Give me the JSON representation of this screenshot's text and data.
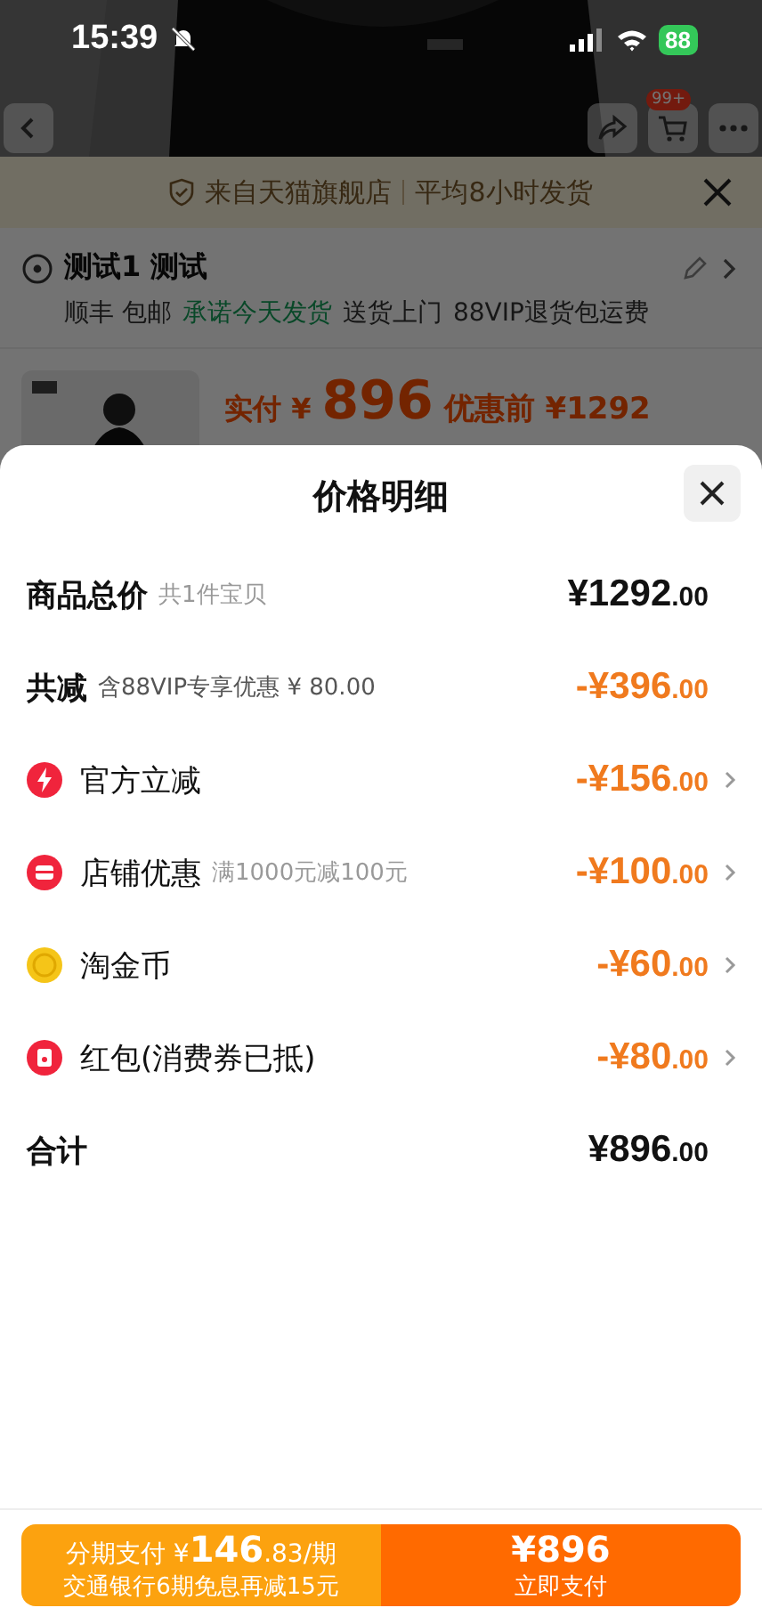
{
  "status_bar": {
    "time": "15:39",
    "battery": "88"
  },
  "nav": {
    "cart_badge": "99+"
  },
  "banner": {
    "source": "来自天猫旗舰店",
    "shipping": "平均8小时发货"
  },
  "address": {
    "name": "测试1 测试",
    "tags": [
      {
        "text": "顺丰 包邮",
        "highlighted": false
      },
      {
        "text": "承诺今天发货",
        "highlighted": true
      },
      {
        "text": "送货上门",
        "highlighted": false
      },
      {
        "text": "88VIP退货包运费",
        "highlighted": false
      }
    ]
  },
  "product": {
    "paid_label": "实付 ¥",
    "paid": "896",
    "before": "优惠前 ¥1292"
  },
  "sheet": {
    "title": "价格明细",
    "rows": [
      {
        "kind": "summary",
        "label": "商品总价",
        "note": "共1件宝贝",
        "amount": "¥1292",
        "decimals": ".00"
      },
      {
        "kind": "reduction",
        "label": "共减",
        "note": "含88VIP专享优惠 ¥ 80.00",
        "amount": "-¥396",
        "decimals": ".00"
      },
      {
        "kind": "bolt",
        "label": "官方立减",
        "amount": "-¥156",
        "decimals": ".00"
      },
      {
        "kind": "shop",
        "label": "店铺优惠",
        "note": "满1000元减100元",
        "amount": "-¥100",
        "decimals": ".00"
      },
      {
        "kind": "coin",
        "label": "淘金币",
        "amount": "-¥60",
        "decimals": ".00"
      },
      {
        "kind": "packet",
        "label": "红包(消费券已抵)",
        "amount": "-¥80",
        "decimals": ".00"
      },
      {
        "kind": "total",
        "label": "合计",
        "amount": "¥896",
        "decimals": ".00"
      }
    ],
    "footer": {
      "installment": {
        "prefix": "分期支付 ¥",
        "amount": "146",
        "suffix": ".83/期",
        "note": "交通银行6期免息再减15元"
      },
      "pay": {
        "amount": "¥896",
        "label": "立即支付"
      }
    }
  }
}
